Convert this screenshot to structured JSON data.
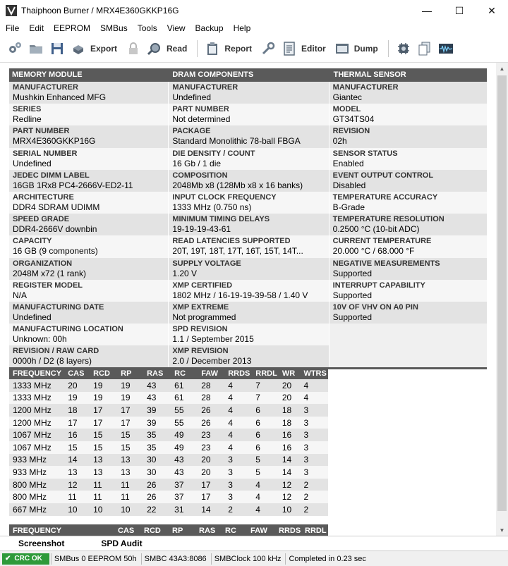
{
  "window": {
    "title": "Thaiphoon Burner / MRX4E360GKKP16G",
    "minimize": "—",
    "maximize": "☐",
    "close": "✕"
  },
  "menu": [
    "File",
    "Edit",
    "EEPROM",
    "SMBus",
    "Tools",
    "View",
    "Backup",
    "Help"
  ],
  "toolbar": {
    "export": "Export",
    "read": "Read",
    "report": "Report",
    "editor": "Editor",
    "dump": "Dump"
  },
  "sections": {
    "memory_module": {
      "header": "MEMORY MODULE",
      "fields": [
        {
          "label": "MANUFACTURER",
          "value": "Mushkin Enhanced MFG"
        },
        {
          "label": "SERIES",
          "value": "Redline"
        },
        {
          "label": "PART NUMBER",
          "value": "MRX4E360GKKP16G"
        },
        {
          "label": "SERIAL NUMBER",
          "value": "Undefined"
        },
        {
          "label": "JEDEC DIMM LABEL",
          "value": "16GB 1Rx8 PC4-2666V-ED2-11"
        },
        {
          "label": "ARCHITECTURE",
          "value": "DDR4 SDRAM UDIMM"
        },
        {
          "label": "SPEED GRADE",
          "value": "DDR4-2666V downbin"
        },
        {
          "label": "CAPACITY",
          "value": "16 GB (9 components)"
        },
        {
          "label": "ORGANIZATION",
          "value": "2048M x72 (1 rank)"
        },
        {
          "label": "REGISTER MODEL",
          "value": "N/A"
        },
        {
          "label": "MANUFACTURING DATE",
          "value": "Undefined"
        },
        {
          "label": "MANUFACTURING LOCATION",
          "value": "Unknown: 00h"
        },
        {
          "label": "REVISION / RAW CARD",
          "value": "0000h / D2 (8 layers)"
        }
      ]
    },
    "dram_components": {
      "header": "DRAM COMPONENTS",
      "fields": [
        {
          "label": "MANUFACTURER",
          "value": "Undefined"
        },
        {
          "label": "PART NUMBER",
          "value": "Not determined"
        },
        {
          "label": "PACKAGE",
          "value": "Standard Monolithic 78-ball FBGA"
        },
        {
          "label": "DIE DENSITY / COUNT",
          "value": "16 Gb / 1 die"
        },
        {
          "label": "COMPOSITION",
          "value": "2048Mb x8 (128Mb x8 x 16 banks)"
        },
        {
          "label": "INPUT CLOCK FREQUENCY",
          "value": "1333 MHz (0.750 ns)"
        },
        {
          "label": "MINIMUM TIMING DELAYS",
          "value": "19-19-19-43-61"
        },
        {
          "label": "READ LATENCIES SUPPORTED",
          "value": "20T, 19T, 18T, 17T, 16T, 15T, 14T..."
        },
        {
          "label": "SUPPLY VOLTAGE",
          "value": "1.20 V"
        },
        {
          "label": "XMP CERTIFIED",
          "value": "1802 MHz / 16-19-19-39-58 / 1.40 V"
        },
        {
          "label": "XMP EXTREME",
          "value": "Not programmed"
        },
        {
          "label": "SPD REVISION",
          "value": "1.1 / September 2015"
        },
        {
          "label": "XMP REVISION",
          "value": "2.0 / December 2013"
        }
      ]
    },
    "thermal_sensor": {
      "header": "THERMAL SENSOR",
      "fields": [
        {
          "label": "MANUFACTURER",
          "value": "Giantec"
        },
        {
          "label": "MODEL",
          "value": "GT34TS04"
        },
        {
          "label": "REVISION",
          "value": "02h"
        },
        {
          "label": "SENSOR STATUS",
          "value": "Enabled"
        },
        {
          "label": "EVENT OUTPUT CONTROL",
          "value": "Disabled"
        },
        {
          "label": "TEMPERATURE ACCURACY",
          "value": "B-Grade"
        },
        {
          "label": "TEMPERATURE RESOLUTION",
          "value": "0.2500 °C (10-bit ADC)"
        },
        {
          "label": "CURRENT TEMPERATURE",
          "value": "20.000 °C / 68.000 °F"
        },
        {
          "label": "NEGATIVE MEASUREMENTS",
          "value": "Supported"
        },
        {
          "label": "INTERRUPT CAPABILITY",
          "value": "Supported"
        },
        {
          "label": "10V OF VHV ON A0 PIN",
          "value": "Supported"
        }
      ]
    }
  },
  "timings": {
    "headers": [
      "FREQUENCY",
      "CAS",
      "RCD",
      "RP",
      "RAS",
      "RC",
      "FAW",
      "RRDS",
      "RRDL",
      "WR",
      "WTRS"
    ],
    "rows": [
      [
        "1333 MHz",
        "20",
        "19",
        "19",
        "43",
        "61",
        "28",
        "4",
        "7",
        "20",
        "4"
      ],
      [
        "1333 MHz",
        "19",
        "19",
        "19",
        "43",
        "61",
        "28",
        "4",
        "7",
        "20",
        "4"
      ],
      [
        "1200 MHz",
        "18",
        "17",
        "17",
        "39",
        "55",
        "26",
        "4",
        "6",
        "18",
        "3"
      ],
      [
        "1200 MHz",
        "17",
        "17",
        "17",
        "39",
        "55",
        "26",
        "4",
        "6",
        "18",
        "3"
      ],
      [
        "1067 MHz",
        "16",
        "15",
        "15",
        "35",
        "49",
        "23",
        "4",
        "6",
        "16",
        "3"
      ],
      [
        "1067 MHz",
        "15",
        "15",
        "15",
        "35",
        "49",
        "23",
        "4",
        "6",
        "16",
        "3"
      ],
      [
        "933 MHz",
        "14",
        "13",
        "13",
        "30",
        "43",
        "20",
        "3",
        "5",
        "14",
        "3"
      ],
      [
        "933 MHz",
        "13",
        "13",
        "13",
        "30",
        "43",
        "20",
        "3",
        "5",
        "14",
        "3"
      ],
      [
        "800 MHz",
        "12",
        "11",
        "11",
        "26",
        "37",
        "17",
        "3",
        "4",
        "12",
        "2"
      ],
      [
        "800 MHz",
        "11",
        "11",
        "11",
        "26",
        "37",
        "17",
        "3",
        "4",
        "12",
        "2"
      ],
      [
        "667 MHz",
        "10",
        "10",
        "10",
        "22",
        "31",
        "14",
        "2",
        "4",
        "10",
        "2"
      ]
    ]
  },
  "xmp_timings": {
    "headers": [
      "FREQUENCY",
      "CAS",
      "RCD",
      "RP",
      "RAS",
      "RC",
      "FAW",
      "RRDS",
      "RRDL"
    ]
  },
  "tabs": [
    "Screenshot",
    "SPD Audit"
  ],
  "status": {
    "crc": "CRC OK",
    "smbus": "SMBus 0 EEPROM 50h",
    "smbc": "SMBC 43A3:8086",
    "clock": "SMBClock 100 kHz",
    "completed": "Completed in 0.23 sec"
  }
}
